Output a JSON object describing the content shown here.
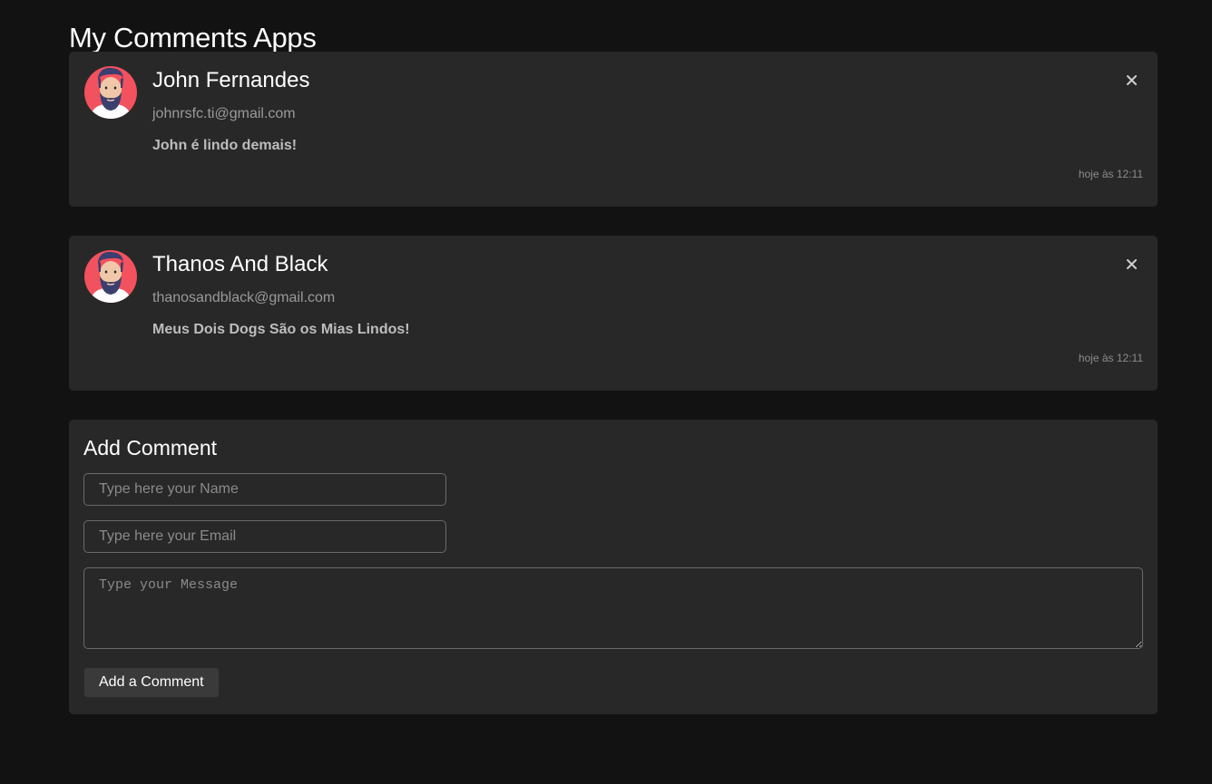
{
  "app": {
    "title": "My Comments Apps"
  },
  "comments": [
    {
      "name": "John Fernandes",
      "email": "johnrsfc.ti@gmail.com",
      "message": "John é lindo demais!",
      "time": "hoje às 12:11",
      "avatar_icon": "bearded-man-avatar",
      "close_icon": "close-icon"
    },
    {
      "name": "Thanos And Black",
      "email": "thanosandblack@gmail.com",
      "message": "Meus Dois Dogs São os Mias Lindos!",
      "time": "hoje às 12:11",
      "avatar_icon": "bearded-man-avatar",
      "close_icon": "close-icon"
    }
  ],
  "form": {
    "title": "Add Comment",
    "name_placeholder": "Type here your Name",
    "email_placeholder": "Type here your Email",
    "message_placeholder": "Type your Message",
    "name_value": "",
    "email_value": "",
    "message_value": "",
    "submit_label": "Add a Comment"
  },
  "colors": {
    "background": "#121212",
    "card": "#282828",
    "avatar_bg": "#f2515e",
    "muted_text": "#9a9a9a"
  }
}
